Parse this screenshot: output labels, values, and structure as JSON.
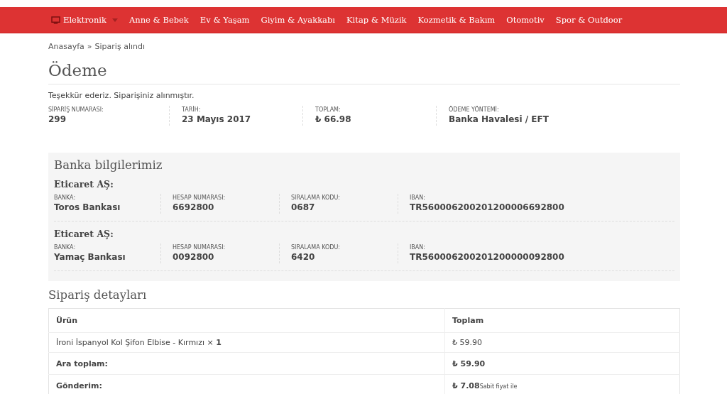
{
  "nav": {
    "items": [
      {
        "label": "Elektronik",
        "kind": "dropdown"
      },
      {
        "label": "Anne & Bebek",
        "kind": "link"
      },
      {
        "label": "Ev & Yaşam",
        "kind": "link"
      },
      {
        "label": "Giyim & Ayakkabı",
        "kind": "link"
      },
      {
        "label": "Kitap & Müzik",
        "kind": "link"
      },
      {
        "label": "Kozmetik & Bakım",
        "kind": "link"
      },
      {
        "label": "Otomotiv",
        "kind": "link"
      },
      {
        "label": "Spor & Outdoor",
        "kind": "link"
      }
    ]
  },
  "breadcrumb": [
    "Anasayfa",
    "»",
    "Sipariş alındı"
  ],
  "title": "Ödeme",
  "thanks": "Teşekkür ederiz. Siparişiniz alınmıştır.",
  "overview": [
    {
      "label": "SİPARİŞ NUMARASI:",
      "value": "299"
    },
    {
      "label": "TARİH:",
      "value": "23 Mayıs 2017"
    },
    {
      "label": "TOPLAM:",
      "value": "₺ 66.98"
    },
    {
      "label": "ÖDEME YÖNTEMİ:",
      "value": "Banka Havalesi / EFT"
    }
  ],
  "bank": {
    "title": "Banka bilgilerimiz",
    "accounts": [
      {
        "company": "Eticaret AŞ:",
        "fields": [
          {
            "label": "BANKA:",
            "value": "Toros Bankası"
          },
          {
            "label": "HESAP NUMARASI:",
            "value": "6692800"
          },
          {
            "label": "SIRALAMA KODU:",
            "value": "0687"
          },
          {
            "label": "IBAN:",
            "value": "TR560006200201200006692800"
          }
        ]
      },
      {
        "company": "Eticaret AŞ:",
        "fields": [
          {
            "label": "BANKA:",
            "value": "Yamaç Bankası"
          },
          {
            "label": "HESAP NUMARASI:",
            "value": "0092800"
          },
          {
            "label": "SIRALAMA KODU:",
            "value": "6420"
          },
          {
            "label": "IBAN:",
            "value": "TR560006200201200000092800"
          }
        ]
      }
    ]
  },
  "details": {
    "title": "Sipariş detayları",
    "columns": [
      "Ürün",
      "Toplam"
    ],
    "rows": [
      {
        "kind": "item",
        "name": "İroni İspanyol Kol Şifon Elbise - Kırmızı × **1**",
        "total": "₺ 59.90"
      },
      {
        "kind": "total",
        "name": "Ara toplam:",
        "total": "₺ 59.90"
      },
      {
        "kind": "total",
        "name": "Gönderim:",
        "total": "₺ 7.08",
        "note": "Sabit fiyat ile"
      }
    ]
  }
}
